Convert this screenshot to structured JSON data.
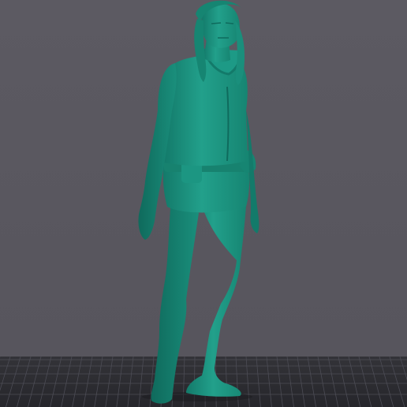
{
  "viewport": {
    "background_color": "#59575f",
    "model_color": "#1e9b87",
    "plate_color": "#2b2b30",
    "grid_color": "#4a4a52"
  },
  "plate": {
    "logo_left": "",
    "logo_center": ""
  }
}
